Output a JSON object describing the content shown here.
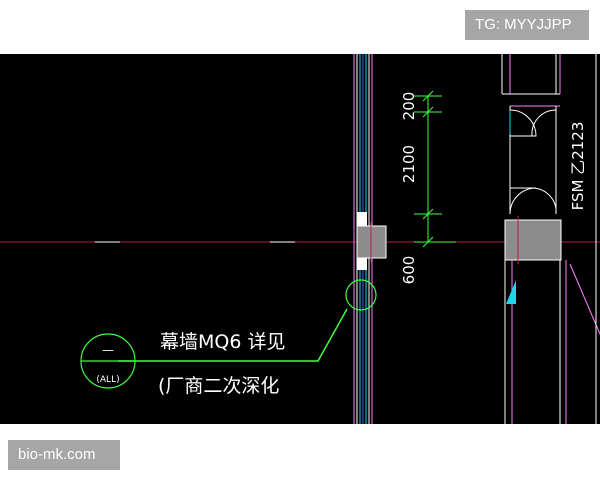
{
  "watermarks": {
    "tg_label": "TG: MYYJJPP",
    "site_label": "bio-mk.com"
  },
  "drawing": {
    "annotation_line1": "幕墙MQ6 详见",
    "annotation_line2": "(厂商二次深化",
    "detail_bubble_top": "—",
    "detail_bubble_bottom": "(ALL)",
    "dim_top": "200",
    "dim_middle": "2100",
    "dim_bottom": "600",
    "door_tag": "FSM 乙2123"
  },
  "colors": {
    "background": "#000000",
    "axis_line": "#b0204a",
    "wall_white": "#ffffff",
    "glazing_cyan": "#1fd6e8",
    "glazing_blue": "#5060ff",
    "pink_line": "#ff80ff",
    "dim_green": "#3dff3d",
    "column_gray": "#8c8c8c",
    "text_white": "#ffffff"
  }
}
